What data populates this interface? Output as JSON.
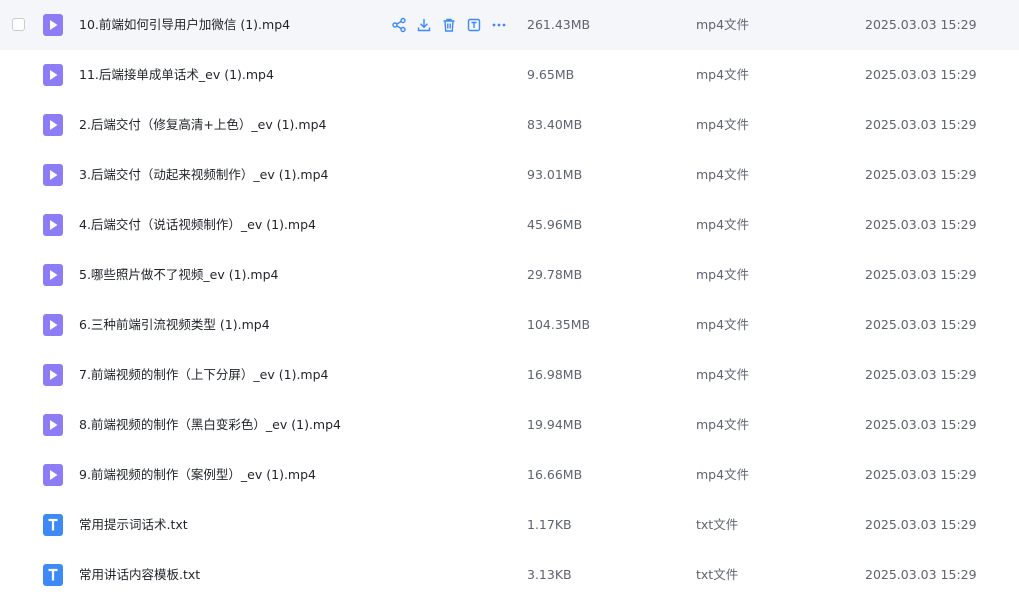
{
  "colors": {
    "video_icon": "#8c7cf5",
    "text_icon": "#3d8af7",
    "action_icon": "#3d8af7",
    "hover_row": "#f5f6fa"
  },
  "row_actions": [
    "share-icon",
    "download-icon",
    "delete-icon",
    "rename-icon",
    "more-icon"
  ],
  "files": [
    {
      "name": "10.前端如何引导用户加微信 (1).mp4",
      "size": "261.43MB",
      "type": "mp4文件",
      "date": "2025.03.03 15:29",
      "icon": "video-file-icon",
      "hovered": true
    },
    {
      "name": "11.后端接单成单话术_ev (1).mp4",
      "size": "9.65MB",
      "type": "mp4文件",
      "date": "2025.03.03 15:29",
      "icon": "video-file-icon"
    },
    {
      "name": "2.后端交付（修复高清+上色）_ev (1).mp4",
      "size": "83.40MB",
      "type": "mp4文件",
      "date": "2025.03.03 15:29",
      "icon": "video-file-icon"
    },
    {
      "name": "3.后端交付（动起来视频制作）_ev (1).mp4",
      "size": "93.01MB",
      "type": "mp4文件",
      "date": "2025.03.03 15:29",
      "icon": "video-file-icon"
    },
    {
      "name": "4.后端交付（说话视频制作）_ev (1).mp4",
      "size": "45.96MB",
      "type": "mp4文件",
      "date": "2025.03.03 15:29",
      "icon": "video-file-icon"
    },
    {
      "name": "5.哪些照片做不了视频_ev (1).mp4",
      "size": "29.78MB",
      "type": "mp4文件",
      "date": "2025.03.03 15:29",
      "icon": "video-file-icon"
    },
    {
      "name": "6.三种前端引流视频类型 (1).mp4",
      "size": "104.35MB",
      "type": "mp4文件",
      "date": "2025.03.03 15:29",
      "icon": "video-file-icon"
    },
    {
      "name": "7.前端视频的制作（上下分屏）_ev (1).mp4",
      "size": "16.98MB",
      "type": "mp4文件",
      "date": "2025.03.03 15:29",
      "icon": "video-file-icon"
    },
    {
      "name": "8.前端视频的制作（黑白变彩色）_ev (1).mp4",
      "size": "19.94MB",
      "type": "mp4文件",
      "date": "2025.03.03 15:29",
      "icon": "video-file-icon"
    },
    {
      "name": "9.前端视频的制作（案例型）_ev (1).mp4",
      "size": "16.66MB",
      "type": "mp4文件",
      "date": "2025.03.03 15:29",
      "icon": "video-file-icon"
    },
    {
      "name": "常用提示词话术.txt",
      "size": "1.17KB",
      "type": "txt文件",
      "date": "2025.03.03 15:29",
      "icon": "text-file-icon"
    },
    {
      "name": "常用讲话内容模板.txt",
      "size": "3.13KB",
      "type": "txt文件",
      "date": "2025.03.03 15:29",
      "icon": "text-file-icon"
    }
  ]
}
